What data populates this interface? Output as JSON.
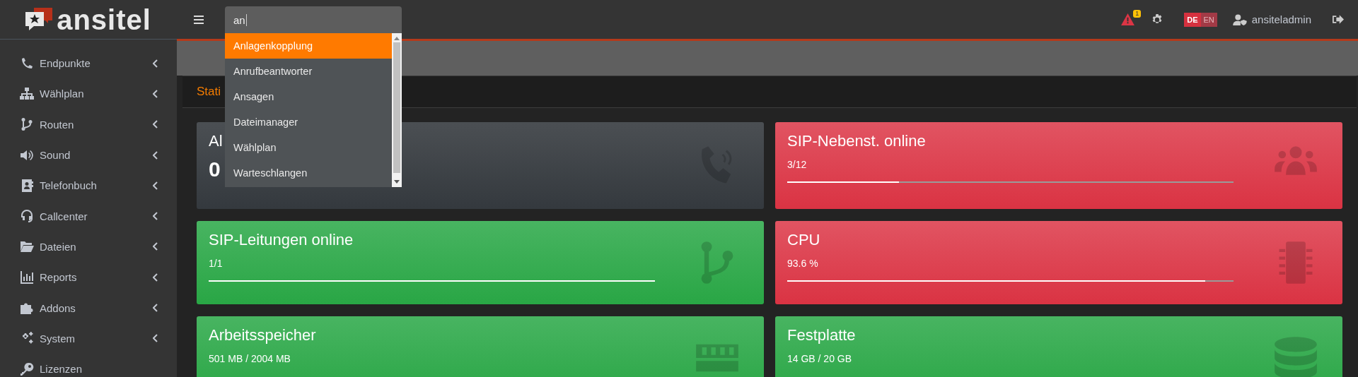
{
  "logo": {
    "text": "ansitel"
  },
  "sidebar": {
    "items": [
      {
        "label": "Endpunkte",
        "expandable": true
      },
      {
        "label": "Wählplan",
        "expandable": true
      },
      {
        "label": "Routen",
        "expandable": true
      },
      {
        "label": "Sound",
        "expandable": true
      },
      {
        "label": "Telefonbuch",
        "expandable": true
      },
      {
        "label": "Callcenter",
        "expandable": true
      },
      {
        "label": "Dateien",
        "expandable": true
      },
      {
        "label": "Reports",
        "expandable": true
      },
      {
        "label": "Addons",
        "expandable": true
      },
      {
        "label": "System",
        "expandable": true
      },
      {
        "label": "Lizenzen",
        "expandable": false
      }
    ]
  },
  "search": {
    "value": "an",
    "suggestions": [
      {
        "label": "Anlagenkopplung",
        "selected": true
      },
      {
        "label": "Anrufbeantworter",
        "selected": false
      },
      {
        "label": "Ansagen",
        "selected": false
      },
      {
        "label": "Dateimanager",
        "selected": false
      },
      {
        "label": "Wählplan",
        "selected": false
      },
      {
        "label": "Warteschlangen",
        "selected": false
      }
    ]
  },
  "header": {
    "alert_count": "1",
    "languages": [
      {
        "label": "DE",
        "selected": true
      },
      {
        "label": "EN",
        "selected": false
      }
    ],
    "user": "ansiteladmin"
  },
  "panel": {
    "title": "Stati"
  },
  "cards": [
    {
      "kind": "dark",
      "title": "Al",
      "value": "0"
    },
    {
      "kind": "red",
      "title": "SIP-Nebenst. online",
      "value": "3/12",
      "level": 0.25
    },
    {
      "kind": "green",
      "title": "SIP-Leitungen online",
      "value": "1/1",
      "level": 1
    },
    {
      "kind": "red",
      "title": "CPU",
      "value": "93.6 %",
      "level": 0.936
    },
    {
      "kind": "green",
      "title": "Arbeitsspeicher",
      "value": "501 MB / 2004 MB"
    },
    {
      "kind": "green",
      "title": "Festplatte",
      "value": "14 GB / 20 GB"
    }
  ]
}
